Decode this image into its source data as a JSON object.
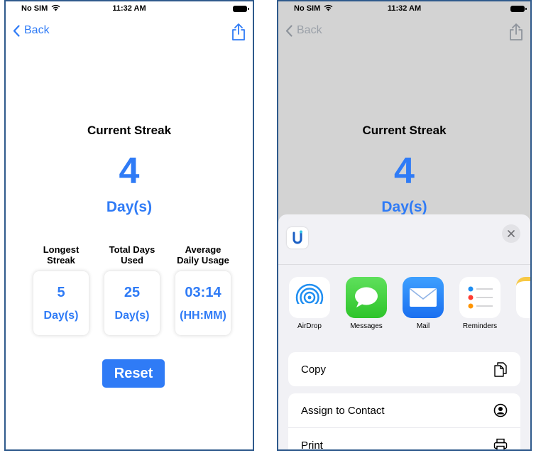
{
  "screen1": {
    "status": {
      "carrier": "No SIM",
      "time": "11:32 AM"
    },
    "nav": {
      "back_label": "Back"
    },
    "current_streak": {
      "title": "Current Streak",
      "value": "4",
      "unit": "Day(s)"
    },
    "stats": [
      {
        "label_line1": "Longest",
        "label_line2": "Streak",
        "value": "5",
        "unit": "Day(s)"
      },
      {
        "label_line1": "Total Days",
        "label_line2": "Used",
        "value": "25",
        "unit": "Day(s)"
      },
      {
        "label_line1": "Average",
        "label_line2": "Daily Usage",
        "value": "03:14",
        "unit": "(HH:MM)"
      }
    ],
    "reset_label": "Reset"
  },
  "screen2": {
    "status": {
      "carrier": "No SIM",
      "time": "11:32 AM"
    },
    "nav": {
      "back_label": "Back"
    },
    "current_streak": {
      "title": "Current Streak",
      "value": "4",
      "unit": "Day(s)"
    },
    "share_sheet": {
      "apps": [
        {
          "label": "AirDrop",
          "icon": "airdrop-icon"
        },
        {
          "label": "Messages",
          "icon": "messages-icon"
        },
        {
          "label": "Mail",
          "icon": "mail-icon"
        },
        {
          "label": "Reminders",
          "icon": "reminders-icon"
        }
      ],
      "actions": [
        {
          "label": "Copy",
          "icon": "copy-icon"
        },
        {
          "label": "Assign to Contact",
          "icon": "contact-icon"
        },
        {
          "label": "Print",
          "icon": "print-icon"
        }
      ]
    }
  },
  "colors": {
    "accent": "#2f7bf6",
    "dim_background": "#d3d3d3",
    "sheet_background": "#f1f1f5"
  }
}
